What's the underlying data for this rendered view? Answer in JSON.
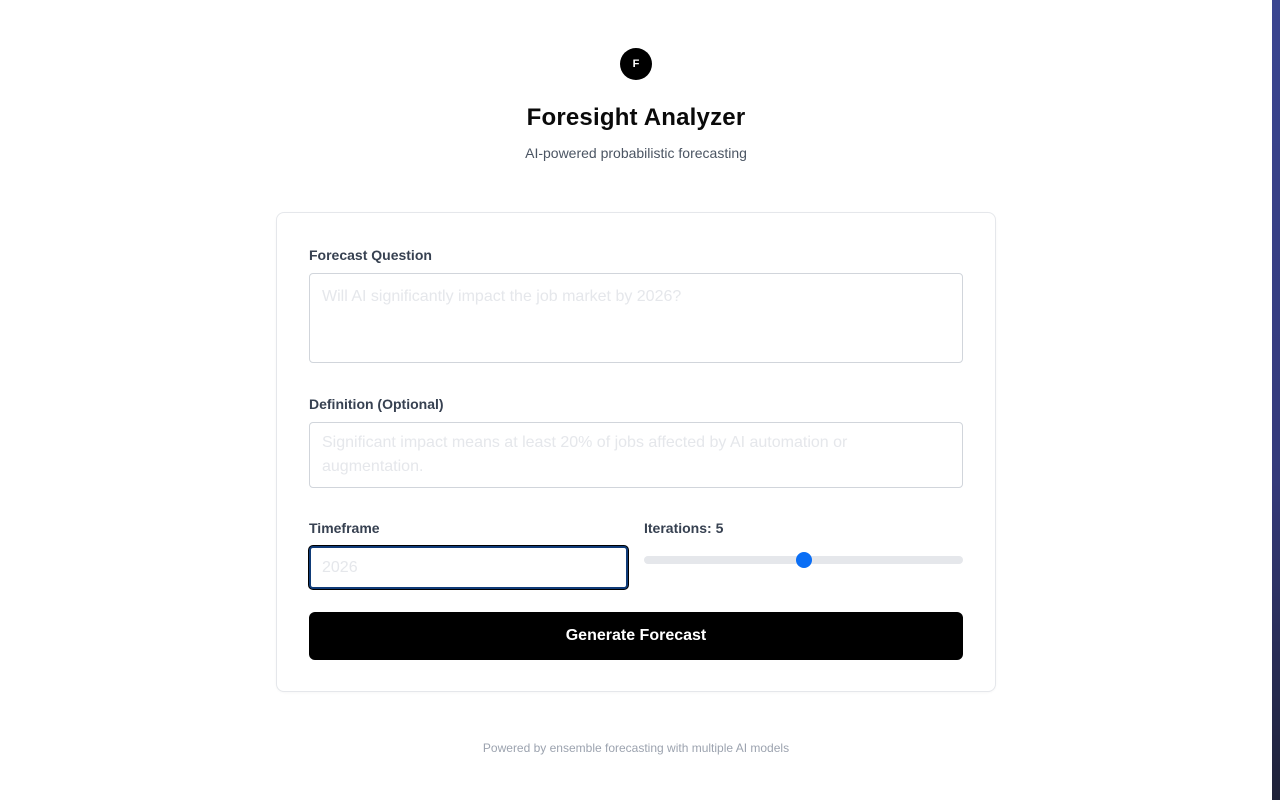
{
  "header": {
    "logo_letter": "F",
    "title": "Foresight Analyzer",
    "subtitle": "AI-powered probabilistic forecasting"
  },
  "form": {
    "question": {
      "label": "Forecast Question",
      "value": "",
      "placeholder": "Will AI significantly impact the job market by 2026?"
    },
    "definition": {
      "label": "Definition (Optional)",
      "value": "",
      "placeholder": "Significant impact means at least 20% of jobs affected by AI automation or augmentation."
    },
    "timeframe": {
      "label": "Timeframe",
      "value": "",
      "placeholder": "2026",
      "focused": true
    },
    "iterations": {
      "label": "Iterations: 5",
      "value": 5,
      "min": 1,
      "max": 9
    },
    "submit_label": "Generate Forecast"
  },
  "footer": {
    "text": "Powered by ensemble forecasting with multiple AI models"
  },
  "colors": {
    "accent": "#0a6ef5",
    "button_bg": "#000000",
    "focus_ring": "#0f3b78"
  }
}
